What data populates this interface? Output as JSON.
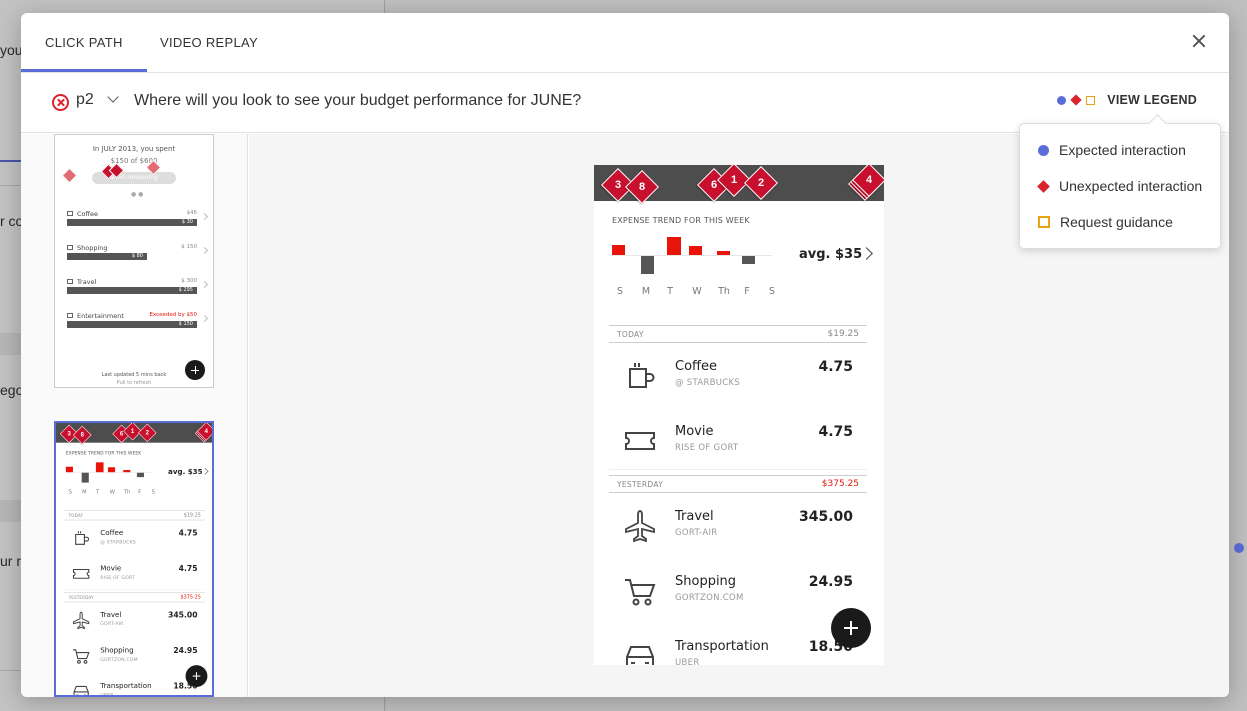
{
  "background": {
    "left_fragments": [
      "you",
      "r co",
      "ego",
      "ur m"
    ]
  },
  "tabs": [
    {
      "label": "CLICK PATH",
      "active": true
    },
    {
      "label": "VIDEO REPLAY",
      "active": false
    }
  ],
  "question_bar": {
    "participant": "p2",
    "status_icon": "failed-x-circle-icon",
    "question": "Where will you look to see your budget performance for JUNE?"
  },
  "legend": {
    "trigger_label": "VIEW LEGEND",
    "items": [
      {
        "label": "Expected interaction",
        "symbol": "blue-circle",
        "color": "#5b6dd8"
      },
      {
        "label": "Unexpected interaction",
        "symbol": "red-diamond",
        "color": "#d9242f"
      },
      {
        "label": "Request guidance",
        "symbol": "orange-square",
        "color": "#e8a317"
      }
    ]
  },
  "thumb1": {
    "header": "In JULY 2013, you spent",
    "spent": "$150 of $600",
    "pill": "$450 remaining",
    "rows": [
      {
        "name": "Coffee",
        "limit": "$45",
        "value": "$ 30"
      },
      {
        "name": "Shopping",
        "limit": "$ 150",
        "value": "$ 80"
      },
      {
        "name": "Travel",
        "limit": "$ 300",
        "value": "$ 295"
      },
      {
        "name": "Entertainment",
        "limit": "Exceeded by $50",
        "value": "$ 150"
      }
    ],
    "updated": "Last updated 5 mins back",
    "pull": "Pull to refresh"
  },
  "screen": {
    "trend_title": "EXPENSE TREND FOR THIS WEEK",
    "avg": "avg. $35",
    "days": [
      "S",
      "M",
      "T",
      "W",
      "Th",
      "F",
      "S"
    ],
    "bars": [
      {
        "day": "S",
        "delta": 10
      },
      {
        "day": "M",
        "delta": -18
      },
      {
        "day": "T",
        "delta": 18
      },
      {
        "day": "W",
        "delta": 9
      },
      {
        "day": "Th",
        "delta": 4
      },
      {
        "day": "F",
        "delta": -8
      },
      {
        "day": "S",
        "delta": 0
      }
    ],
    "sections": [
      {
        "label": "TODAY",
        "total": "$19.25",
        "total_red": false,
        "items": [
          {
            "name": "Coffee",
            "sub": "@ STARBUCKS",
            "amount": "4.75",
            "icon": "coffee-cup-icon"
          },
          {
            "name": "Movie",
            "sub": "RISE OF GORT",
            "amount": "4.75",
            "icon": "ticket-icon"
          }
        ]
      },
      {
        "label": "YESTERDAY",
        "total": "$375.25",
        "total_red": true,
        "items": [
          {
            "name": "Travel",
            "sub": "GORT-AIR",
            "amount": "345.00",
            "icon": "airplane-icon"
          },
          {
            "name": "Shopping",
            "sub": "GORTZON.COM",
            "amount": "24.95",
            "icon": "shopping-cart-icon"
          },
          {
            "name": "Transportation",
            "sub": "UBER",
            "amount": "18.50",
            "icon": "car-icon"
          }
        ]
      }
    ],
    "click_markers": [
      "3",
      "8",
      "6",
      "1",
      "2",
      "4"
    ]
  },
  "colors": {
    "accent": "#5b6dd8",
    "unexpected": "#c8102e",
    "guidance": "#e8a317",
    "negative": "#e8140a"
  }
}
